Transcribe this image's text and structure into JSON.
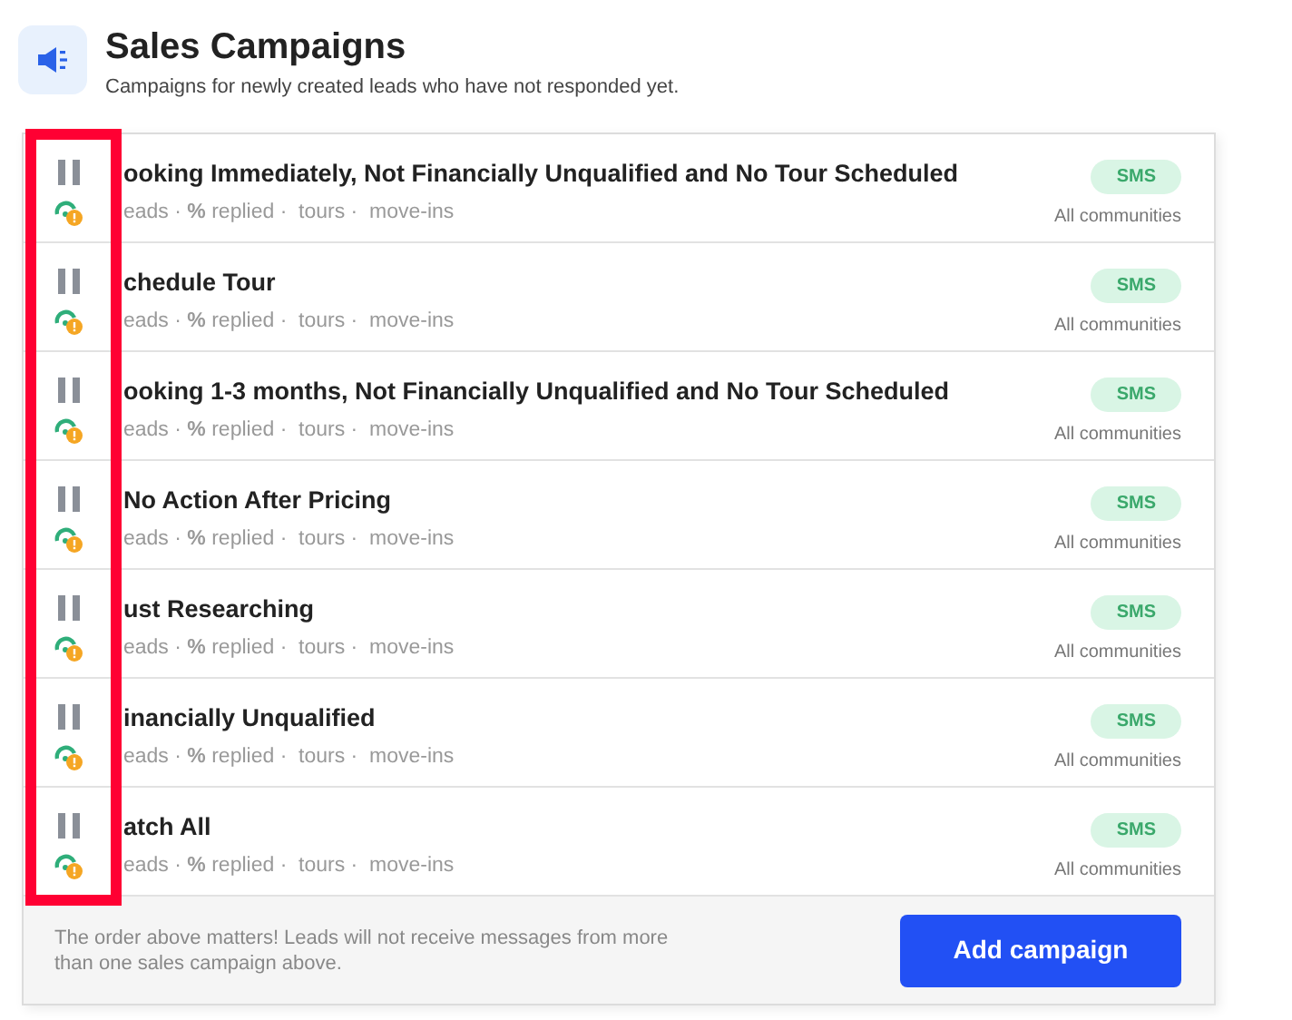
{
  "header": {
    "title": "Sales Campaigns",
    "subtitle": "Campaigns for newly created leads who have not responded yet."
  },
  "campaigns": [
    {
      "title": "ooking Immediately, Not Financially Unqualified and No Tour Scheduled",
      "stats": "eads · **%** replied ·  tours ·  move-ins",
      "channel": "SMS",
      "scope": "All communities",
      "paused": true
    },
    {
      "title": "chedule Tour",
      "stats": "eads · **%** replied ·  tours ·  move-ins",
      "channel": "SMS",
      "scope": "All communities",
      "paused": true
    },
    {
      "title": "ooking 1-3 months, Not Financially Unqualified and No Tour Scheduled",
      "stats": "eads · **%** replied ·  tours ·  move-ins",
      "channel": "SMS",
      "scope": "All communities",
      "paused": true
    },
    {
      "title": "No Action After Pricing",
      "stats": "eads · **%** replied ·  tours ·  move-ins",
      "channel": "SMS",
      "scope": "All communities",
      "paused": true
    },
    {
      "title": "ust Researching",
      "stats": "eads · **%** replied ·  tours ·  move-ins",
      "channel": "SMS",
      "scope": "All communities",
      "paused": true
    },
    {
      "title": "inancially Unqualified",
      "stats": "eads · **%** replied ·  tours ·  move-ins",
      "channel": "SMS",
      "scope": "All communities",
      "paused": true
    },
    {
      "title": "atch All",
      "stats": "eads · **%** replied ·  tours ·  move-ins",
      "channel": "SMS",
      "scope": "All communities",
      "paused": true
    }
  ],
  "footer": {
    "note": "The order above matters! Leads will not receive messages from more than one sales campaign above.",
    "button": "Add campaign"
  }
}
